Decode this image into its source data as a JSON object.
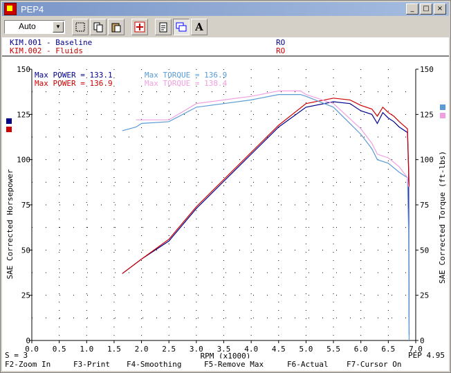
{
  "window": {
    "title": "PEP4",
    "minimize": "_",
    "maximize": "□",
    "close": "×"
  },
  "toolbar": {
    "mode_value": "Auto",
    "text_button": "A"
  },
  "runs": [
    {
      "id": "KIM.001 - Baseline",
      "tag": "RO",
      "color": "#00008b"
    },
    {
      "id": "KIM.002 - Fluids",
      "tag": "RO",
      "color": "#cc0000"
    }
  ],
  "stats": {
    "power1": "Max POWER = 133.1",
    "torque1": "Max TORQUE = 136.9",
    "power2": "Max POWER = 136.9",
    "torque2": "Max TORQUE = 138.4"
  },
  "footer": {
    "smoothing": "S = 3",
    "version": "PEP 4.95"
  },
  "fkeys": [
    "F2-Zoom In",
    "F3-Print",
    "F4-Smoothing",
    "F5-Remove Max",
    "F6-Actual",
    "F7-Cursor On"
  ],
  "colors": {
    "power1": "#00008b",
    "power2": "#cc0000",
    "torque1": "#5b9bd5",
    "torque2": "#f0a0e0"
  },
  "chart_data": {
    "type": "line",
    "xlabel": "RPM (x1000)",
    "ylabel": "SAE Corrected Horsepower",
    "y2label": "SAE Corrected Torque (ft-lbs)",
    "xlim": [
      0,
      7
    ],
    "ylim": [
      0,
      150
    ],
    "xticks": [
      "0.0",
      "0.5",
      "1.0",
      "1.5",
      "2.0",
      "2.5",
      "3.0",
      "3.5",
      "4.0",
      "4.5",
      "5.0",
      "5.5",
      "6.0",
      "6.5",
      "7.0"
    ],
    "yticks": [
      "0",
      "25",
      "50",
      "75",
      "100",
      "125",
      "150"
    ],
    "grid": true,
    "series": [
      {
        "x": [
          1.65,
          2.0,
          2.5,
          3.0,
          3.5,
          4.0,
          4.5,
          5.0,
          5.5,
          5.8,
          6.0,
          6.2,
          6.3,
          6.4,
          6.5,
          6.6,
          6.7,
          6.85,
          6.87,
          6.88
        ],
        "values": [
          37,
          45,
          55,
          73,
          88,
          103,
          118,
          129,
          132,
          131,
          127,
          125,
          120,
          126,
          123,
          121,
          118,
          115,
          94,
          3
        ]
      },
      {
        "x": [
          1.65,
          2.0,
          2.5,
          3.0,
          3.5,
          4.0,
          4.5,
          5.0,
          5.5,
          5.8,
          6.0,
          6.2,
          6.3,
          6.4,
          6.5,
          6.6,
          6.7,
          6.85,
          6.87,
          6.88
        ],
        "values": [
          37,
          45,
          56,
          74,
          89,
          104,
          119,
          131,
          134,
          133,
          130,
          128,
          124,
          129,
          126,
          124,
          121,
          117,
          96,
          85
        ]
      },
      {
        "x": [
          1.65,
          1.9,
          2.0,
          2.5,
          3.0,
          3.5,
          4.0,
          4.5,
          4.9,
          5.0,
          5.5,
          6.0,
          6.2,
          6.3,
          6.5,
          6.7,
          6.85,
          6.87,
          6.88
        ],
        "values": [
          116,
          118,
          120,
          121,
          129,
          131,
          133,
          136,
          136,
          135,
          129,
          114,
          106,
          100,
          98,
          93,
          90,
          60,
          0
        ]
      },
      {
        "x": [
          1.9,
          2.0,
          2.5,
          3.0,
          3.5,
          4.0,
          4.5,
          4.9,
          5.0,
          5.5,
          6.0,
          6.2,
          6.3,
          6.5,
          6.7,
          6.85,
          6.87
        ],
        "values": [
          122,
          122,
          122,
          131,
          133,
          135,
          138,
          138,
          136,
          131,
          117,
          109,
          103,
          101,
          96,
          90,
          85
        ]
      }
    ]
  }
}
